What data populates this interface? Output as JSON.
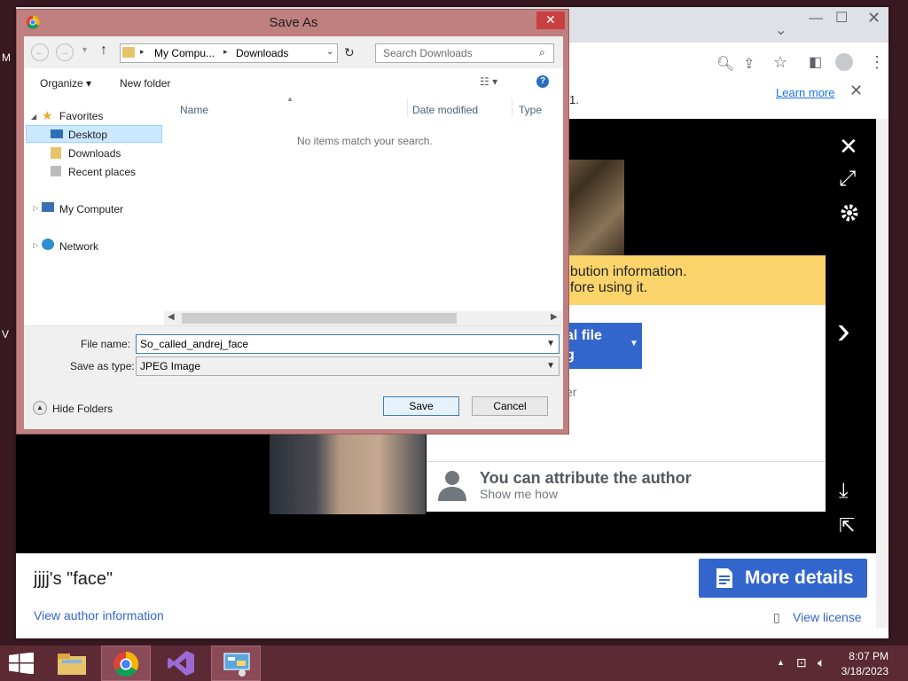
{
  "dialog": {
    "title": "Save As",
    "path": [
      "My Compu...",
      "Downloads"
    ],
    "search_placeholder": "Search Downloads",
    "organize_label": "Organize",
    "new_folder_label": "New folder",
    "tree": {
      "favorites": "Favorites",
      "desktop": "Desktop",
      "downloads": "Downloads",
      "recent": "Recent places",
      "computer": "My Computer",
      "network": "Network"
    },
    "columns": [
      "Name",
      "Date modified",
      "Type"
    ],
    "empty_message": "No items match your search.",
    "file_name_label": "File name:",
    "file_name_value": "So_called_andrej_face",
    "save_type_label": "Save as type:",
    "save_type_value": "JPEG Image",
    "hide_folders": "Hide Folders",
    "save": "Save",
    "cancel": "Cancel"
  },
  "browser": {
    "info_suffix": "1.",
    "learn_more": "Learn more"
  },
  "viewer": {
    "attr_line1": "ribution information.",
    "attr_line2": "efore using it.",
    "use_file_line1": "al file",
    "use_file_line2": "g",
    "attr_partial": "er",
    "attr_title": "You can attribute the author",
    "attr_sub": "Show me how",
    "caption": "jjjj's \"face\"",
    "author_link": "View author information",
    "more_details": "More details",
    "license_link": "View license"
  },
  "desktop_labels": [
    "M",
    "V"
  ],
  "taskbar": {
    "time": "8:07 PM",
    "date": "3/18/2023"
  },
  "colors": {
    "accent_blue": "#3366cc",
    "dialog_frame": "#c08080",
    "taskbar": "#5b2a35",
    "attribution_yellow": "#fbd46b"
  }
}
